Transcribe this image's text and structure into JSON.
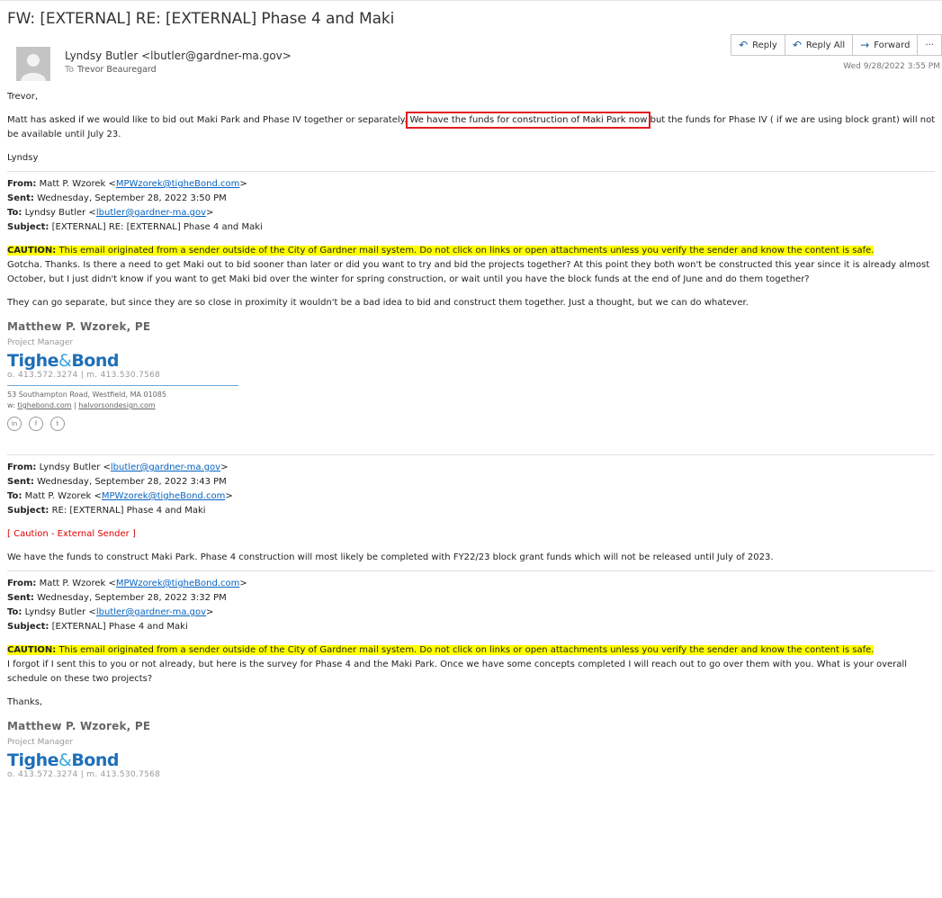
{
  "subject": "FW: [EXTERNAL] RE: [EXTERNAL] Phase 4 and Maki",
  "header": {
    "from": "Lyndsy Butler <lbutler@gardner-ma.gov>",
    "to_label": "To",
    "to": "Trevor Beauregard",
    "date": "Wed 9/28/2022 3:55 PM",
    "actions": {
      "reply": "Reply",
      "reply_all": "Reply All",
      "forward": "Forward",
      "more": "···"
    }
  },
  "message": {
    "greeting": "Trevor,",
    "p1_a": "Matt has asked if we would like to bid out Maki Park and Phase IV together or separately.",
    "p1_highlight": "We have the funds for construction of Maki Park now",
    "p1_b": "but the funds for Phase IV  ( if we are using block grant) will not be available until July 23.",
    "signoff": "Lyndsy"
  },
  "email1": {
    "from_label": "From:",
    "from_name": "Matt P. Wzorek <",
    "from_email": "MPWzorek@tigheBond.com",
    "from_end": ">",
    "sent_label": "Sent:",
    "sent": "Wednesday, September 28, 2022 3:50 PM",
    "to_label": "To:",
    "to_name": "Lyndsy Butler <",
    "to_email": "lbutler@gardner-ma.gov",
    "to_end": ">",
    "subject_label": "Subject:",
    "subject": "[EXTERNAL] RE: [EXTERNAL] Phase 4 and Maki",
    "caution_label": "CAUTION:",
    "caution": "This email originated from a sender outside of the City of Gardner mail system. Do not click on links or open attachments unless you verify the sender and know the content is safe.",
    "p1": "Gotcha.  Thanks.  Is there a need to get Maki out to bid sooner than later or did you want to try and bid the projects together?  At this point they both won't be constructed this year since it is already almost October, but I just didn't know if you want to get Maki bid over the winter for spring construction, or wait until you have the block funds at the end of June and do them together?",
    "p2": "They can go separate, but since they are so close in proximity it wouldn't be a bad idea to bid and construct them together.  Just a thought, but we can do whatever."
  },
  "signature": {
    "name": "Matthew P. Wzorek, PE",
    "title": "Project Manager",
    "logo_a": "Tighe",
    "logo_amp": "&",
    "logo_b": "Bond",
    "phones": "o. 413.572.3274 | m. 413.530.7568",
    "address": "53 Southampton Road, Westfield, MA 01085",
    "web_prefix": "w: ",
    "web1": "tighebond.com",
    "web_sep": " | ",
    "web2": "halvorsondesign.com",
    "social": [
      "in",
      "f",
      "t"
    ]
  },
  "email2": {
    "from_label": "From:",
    "from_name": "Lyndsy Butler <",
    "from_email": "lbutler@gardner-ma.gov",
    "from_end": ">",
    "sent_label": "Sent:",
    "sent": "Wednesday, September 28, 2022 3:43 PM",
    "to_label": "To:",
    "to_name": "Matt P. Wzorek <",
    "to_email": "MPWzorek@tigheBond.com",
    "to_end": ">",
    "subject_label": "Subject:",
    "subject": "RE: [EXTERNAL] Phase 4 and Maki",
    "external_tag": "[ Caution - External Sender ]",
    "p1": "We have the funds to construct Maki Park. Phase 4 construction will most likely be completed with FY22/23 block grant funds which will not be released until July of 2023."
  },
  "email3": {
    "from_label": "From:",
    "from_name": "Matt P. Wzorek <",
    "from_email": "MPWzorek@tigheBond.com",
    "from_end": ">",
    "sent_label": "Sent:",
    "sent": "Wednesday, September 28, 2022 3:32 PM",
    "to_label": "To:",
    "to_name": "Lyndsy Butler <",
    "to_email": "lbutler@gardner-ma.gov",
    "to_end": ">",
    "subject_label": "Subject:",
    "subject": "[EXTERNAL] Phase 4 and Maki",
    "caution_label": "CAUTION:",
    "caution": "This email originated from a sender outside of the City of Gardner mail system. Do not click on links or open attachments unless you verify the sender and know the content is safe.",
    "p1": "I forgot if I sent this to you or not already, but here is the survey for Phase 4 and the Maki Park.  Once we have some concepts completed I will reach out to go over them with you.  What is your overall schedule on these two projects?",
    "thanks": "Thanks,"
  },
  "colors": {
    "caution_highlight": "#ffff00",
    "link": "#0563c1",
    "annotation_box": "#e31b23",
    "brand": "#1e6fb8"
  }
}
